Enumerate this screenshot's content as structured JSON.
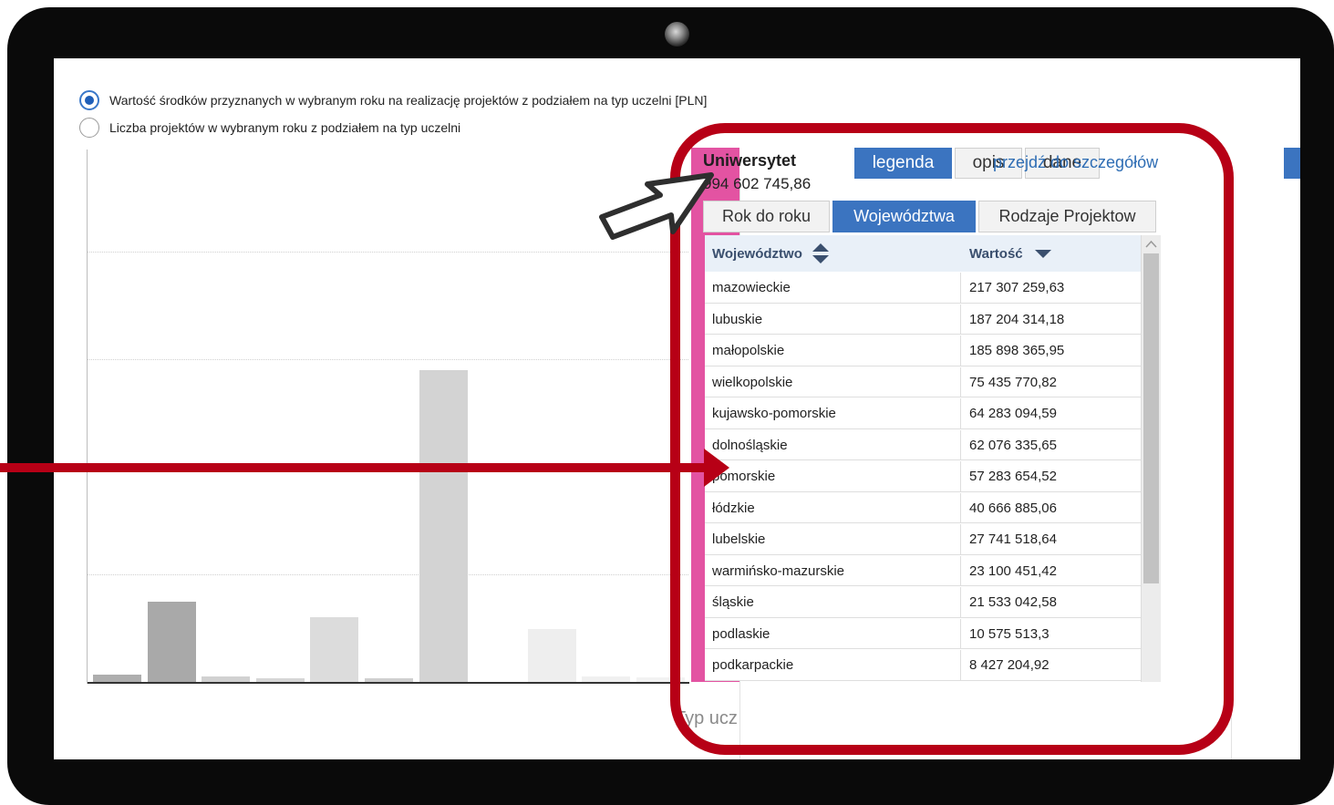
{
  "options": {
    "option1": "Wartość środków przyznanych w wybranym roku na realizację projektów z podziałem na typ uczelni [PLN]",
    "option2": "Liczba projektów w wybranym roku z podziałem na typ uczelni",
    "selected": "option1"
  },
  "chart_data": {
    "type": "bar",
    "values_relative": [
      0.014,
      0.151,
      0.01,
      0.007,
      0.122,
      0.006,
      0.584,
      0.0,
      0.099,
      0.011,
      0.008,
      1.0
    ],
    "colors": [
      "#aeaeae",
      "#a9a9a9",
      "#d1d1d1",
      "#d6d6d6",
      "#dcdcdc",
      "#cfcfcf",
      "#d3d3d3",
      "#ffffff",
      "#eeeeee",
      "#f0f0f0",
      "#f2f2f2",
      "#e353a2"
    ],
    "highlight_index": 11,
    "xlabel": "Typ ucz",
    "grid": true
  },
  "panel": {
    "tabs": [
      "legenda",
      "opis",
      "dane"
    ],
    "active_tab": "legenda",
    "title": "Uniwersytet",
    "value": "994 602 745,86",
    "link": "przejdź do szczegółów",
    "subtabs": [
      "Rok do roku",
      "Województwa",
      "Rodzaje Projektow"
    ],
    "active_subtab": "Województwa",
    "table": {
      "col1": "Województwo",
      "col2": "Wartość",
      "rows": [
        {
          "name": "mazowieckie",
          "value": "217 307 259,63"
        },
        {
          "name": "lubuskie",
          "value": "187 204 314,18"
        },
        {
          "name": "małopolskie",
          "value": "185 898 365,95"
        },
        {
          "name": "wielkopolskie",
          "value": "75 435 770,82"
        },
        {
          "name": "kujawsko-pomorskie",
          "value": "64 283 094,59"
        },
        {
          "name": "dolnośląskie",
          "value": "62 076 335,65"
        },
        {
          "name": "pomorskie",
          "value": "57 283 654,52"
        },
        {
          "name": "łódzkie",
          "value": "40 666 885,06"
        },
        {
          "name": "lubelskie",
          "value": "27 741 518,64"
        },
        {
          "name": "warmińsko-mazurskie",
          "value": "23 100 451,42"
        },
        {
          "name": "śląskie",
          "value": "21 533 042,58"
        },
        {
          "name": "podlaskie",
          "value": "10 575 513,3"
        },
        {
          "name": "podkarpackie",
          "value": "8 427 204,92"
        }
      ]
    }
  },
  "colors": {
    "accent": "#3b74c0",
    "highlight_bar": "#e353a2",
    "callout": "#b70016",
    "frame": "#0a0a0a"
  }
}
